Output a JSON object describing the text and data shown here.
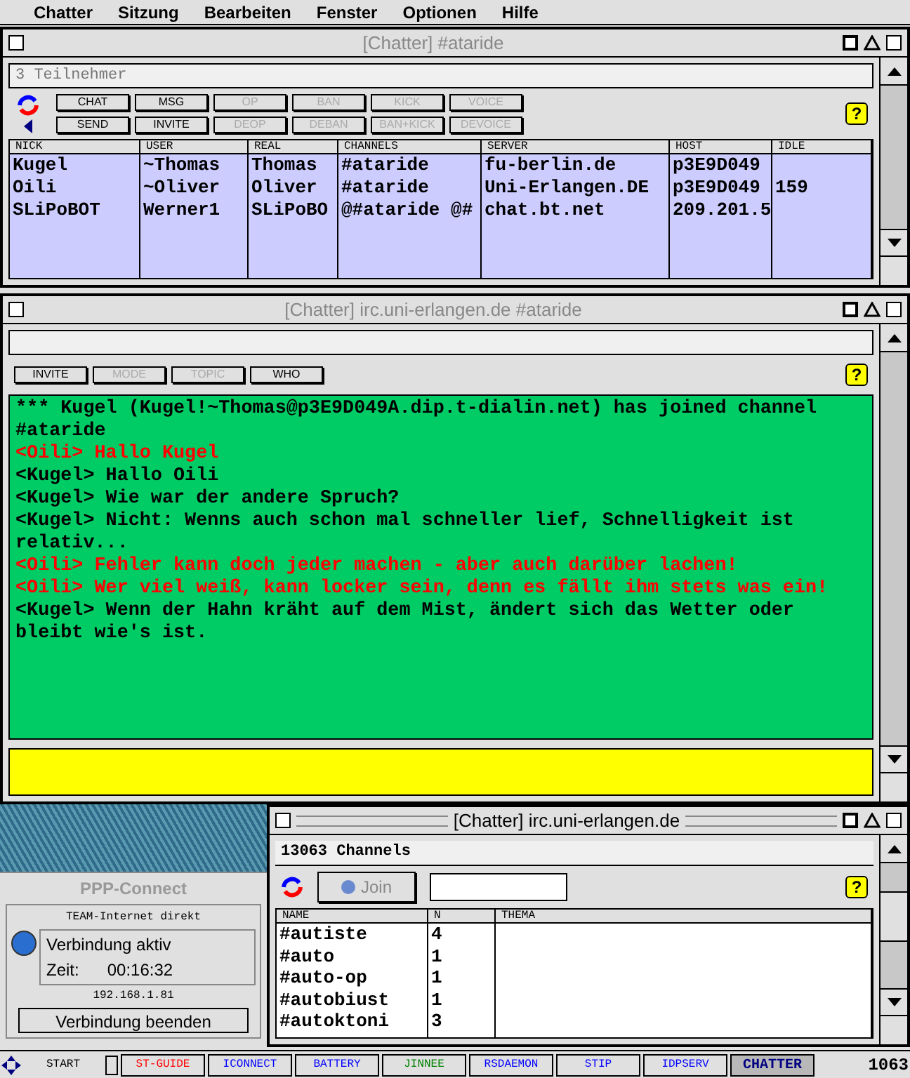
{
  "menu_bar": [
    "Chatter",
    "Sitzung",
    "Bearbeiten",
    "Fenster",
    "Optionen",
    "Hilfe"
  ],
  "users_window": {
    "title": "[Chatter] #ataride",
    "info": "3 Teilnehmer",
    "buttons": [
      {
        "label": "CHAT",
        "disabled": false
      },
      {
        "label": "MSG",
        "disabled": false
      },
      {
        "label": "OP",
        "disabled": true
      },
      {
        "label": "BAN",
        "disabled": true
      },
      {
        "label": "KICK",
        "disabled": true
      },
      {
        "label": "VOICE",
        "disabled": true
      },
      {
        "label": "SEND",
        "disabled": false
      },
      {
        "label": "INVITE",
        "disabled": false
      },
      {
        "label": "DEOP",
        "disabled": true
      },
      {
        "label": "DEBAN",
        "disabled": true
      },
      {
        "label": "BAN+KICK",
        "disabled": true
      },
      {
        "label": "DEVOICE",
        "disabled": true
      }
    ],
    "table": {
      "columns": [
        "NICK",
        "USER",
        "REAL",
        "CHANNELS",
        "SERVER",
        "HOST",
        "IDLE"
      ],
      "rows": [
        [
          "Kugel",
          "~Thomas",
          "Thomas",
          "#ataride",
          "fu-berlin.de",
          "p3E9D049",
          ""
        ],
        [
          "Oili",
          "~Oliver",
          "Oliver",
          "#ataride",
          "Uni-Erlangen.DE",
          "p3E9D049",
          "159"
        ],
        [
          "SLiPoBOT",
          "Werner1",
          "SLiPoBO",
          "@#ataride @#",
          "chat.bt.net",
          "209.201.5",
          ""
        ]
      ]
    }
  },
  "channel_window": {
    "title": "[Chatter] irc.uni-erlangen.de #ataride",
    "buttons": [
      {
        "label": "INVITE",
        "disabled": false
      },
      {
        "label": "MODE",
        "disabled": true
      },
      {
        "label": "TOPIC",
        "disabled": true
      },
      {
        "label": "WHO",
        "disabled": false
      }
    ],
    "messages": [
      {
        "text": "*** Kugel (Kugel!~Thomas@p3E9D049A.dip.t-dialin.net) has joined channel #ataride",
        "color": "#000000"
      },
      {
        "text": "<Oili> Hallo Kugel",
        "color": "#ff0000"
      },
      {
        "text": "<Kugel> Hallo Oili",
        "color": "#000000"
      },
      {
        "text": "<Kugel> Wie war der andere Spruch?",
        "color": "#000000"
      },
      {
        "text": "<Kugel> Nicht: Wenns auch schon mal schneller lief, Schnelligkeit ist relativ...",
        "color": "#000000"
      },
      {
        "text": "<Oili> Fehler kann doch jeder machen - aber auch darüber lachen!",
        "color": "#ff0000"
      },
      {
        "text": "<Oili> Wer viel weiß, kann locker sein, denn es fällt ihm stets was ein!",
        "color": "#ff0000"
      },
      {
        "text": "<Kugel> Wenn der Hahn kräht auf dem Mist, ändert sich das Wetter oder bleibt wie's ist.",
        "color": "#000000"
      }
    ]
  },
  "ppp_connect": {
    "title": "PPP-Connect",
    "provider": "TEAM-Internet direkt",
    "status": "Verbindung aktiv",
    "time_label": "Zeit:",
    "time": "00:16:32",
    "ip": "192.168.1.81",
    "button": "Verbindung beenden"
  },
  "channels_window": {
    "title": "[Chatter] irc.uni-erlangen.de",
    "info": "13063 Channels",
    "join_button": "Join",
    "table": {
      "columns": [
        "NAME",
        "N",
        "THEMA"
      ],
      "rows": [
        [
          "#autiste",
          "4",
          ""
        ],
        [
          "#auto",
          "1",
          ""
        ],
        [
          "#auto-op",
          "1",
          ""
        ],
        [
          "#autobiust",
          "1",
          ""
        ],
        [
          "#autoktoni",
          "3",
          ""
        ]
      ]
    }
  },
  "help_label": "?",
  "taskbar": {
    "start": "START",
    "items": [
      {
        "label": "ST-GUIDE",
        "color": "#ff0000",
        "selected": false
      },
      {
        "label": "ICONNECT",
        "color": "#0000ff",
        "selected": false
      },
      {
        "label": "BATTERY",
        "color": "#0000ff",
        "selected": false
      },
      {
        "label": "JINNEE",
        "color": "#008000",
        "selected": false
      },
      {
        "label": "RSDAEMON",
        "color": "#0000ff",
        "selected": false
      },
      {
        "label": "STIP",
        "color": "#0000ff",
        "selected": false
      },
      {
        "label": "IDPSERV",
        "color": "#0000ff",
        "selected": false
      },
      {
        "label": "CHATTER",
        "color": "#000080",
        "selected": true
      }
    ],
    "clock": "1063"
  }
}
